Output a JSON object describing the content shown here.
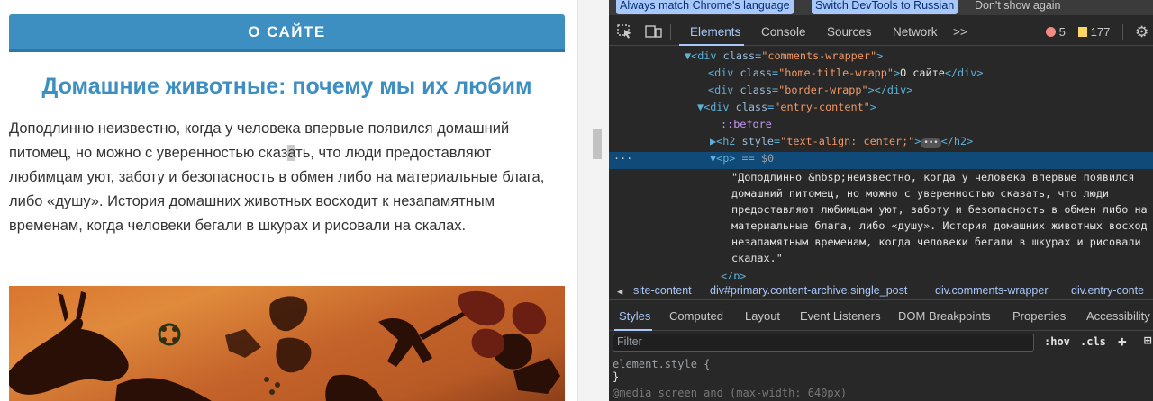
{
  "page": {
    "about_bar": "О САЙТЕ",
    "title": "Домашние животные: почему мы их любим",
    "paragraph_before": "Доподлинно  неизвестно, когда у человека впервые появился домашний питомец, но можно с уверенностью сказ",
    "paragraph_highlight": "а",
    "paragraph_after": "ть, что люди предоставляют любимцам уют, заботу и безопасность в обмен либо на материальные блага, либо «душу». История домашних животных восходит к незапамятным временам, когда человеки бегали в шкурах и рисовали на скалах."
  },
  "devtools": {
    "infobar": {
      "always_match": "Always match Chrome's language",
      "switch": "Switch DevTools to Russian",
      "dont_show": "Don't show again"
    },
    "tabs": [
      "Elements",
      "Console",
      "Sources",
      "Network"
    ],
    "more_tabs": ">>",
    "errors_count": "5",
    "warnings_count": "177",
    "dom": {
      "l1_tag_open": "▼<div ",
      "l1_attr": "class",
      "l1_val": "\"comments-wrapper\"",
      "l2_attr": "class",
      "l2_val": "\"home-title-wrapp\"",
      "l2_text": "О сайте",
      "l3_attr": "class",
      "l3_val": "\"border-wrapp\"",
      "l4_attr": "class",
      "l4_val": "\"entry-content\"",
      "before": "::before",
      "h2_attr": "style",
      "h2_val": "\"text-align: center;\"",
      "p_marker": "== $0",
      "text_lines": [
        "\"Доподлинно &nbsp;неизвестно, когда у человека впервые появился",
        "домашний питомец, но можно с уверенностью сказать, что люди",
        "предоставляют любимцам уют, заботу и безопасность в обмен либо на",
        "материальные блага, либо «душу». История домашних животных восход",
        "незапамятным временам, когда человеки бегали в шкурах и рисовали",
        "скалах.\""
      ]
    },
    "breadcrumbs": [
      "site-content",
      "div#primary.content-archive.single_post",
      "div.comments-wrapper",
      "div.entry-conte"
    ],
    "subtabs": [
      "Styles",
      "Computed",
      "Layout",
      "Event Listeners",
      "DOM Breakpoints",
      "Properties",
      "Accessibility"
    ],
    "filter_placeholder": "Filter",
    "hov": ":hov",
    "cls": ".cls",
    "element_style": "element.style {",
    "close_brace": "}",
    "media_line": "@media screen and (max-width: 640px)"
  }
}
